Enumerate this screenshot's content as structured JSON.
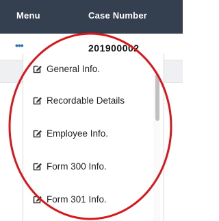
{
  "header": {
    "menu_label": "Menu",
    "case_number_label": "Case Number"
  },
  "row": {
    "actions_glyph": "•••",
    "case_number": "201900002"
  },
  "dropdown": {
    "items": [
      {
        "label": "General Info.",
        "icon": "edit-icon"
      },
      {
        "label": "Recordable Details",
        "icon": "edit-icon"
      },
      {
        "label": "Employee Info.",
        "icon": "edit-icon"
      },
      {
        "label": "Form 300 Info.",
        "icon": "edit-icon"
      },
      {
        "label": "Form 301 Info.",
        "icon": "edit-icon"
      }
    ]
  },
  "colors": {
    "header_bg": "#34404f",
    "link_blue": "#2f6fb5",
    "annotation_red": "#d9161c"
  }
}
